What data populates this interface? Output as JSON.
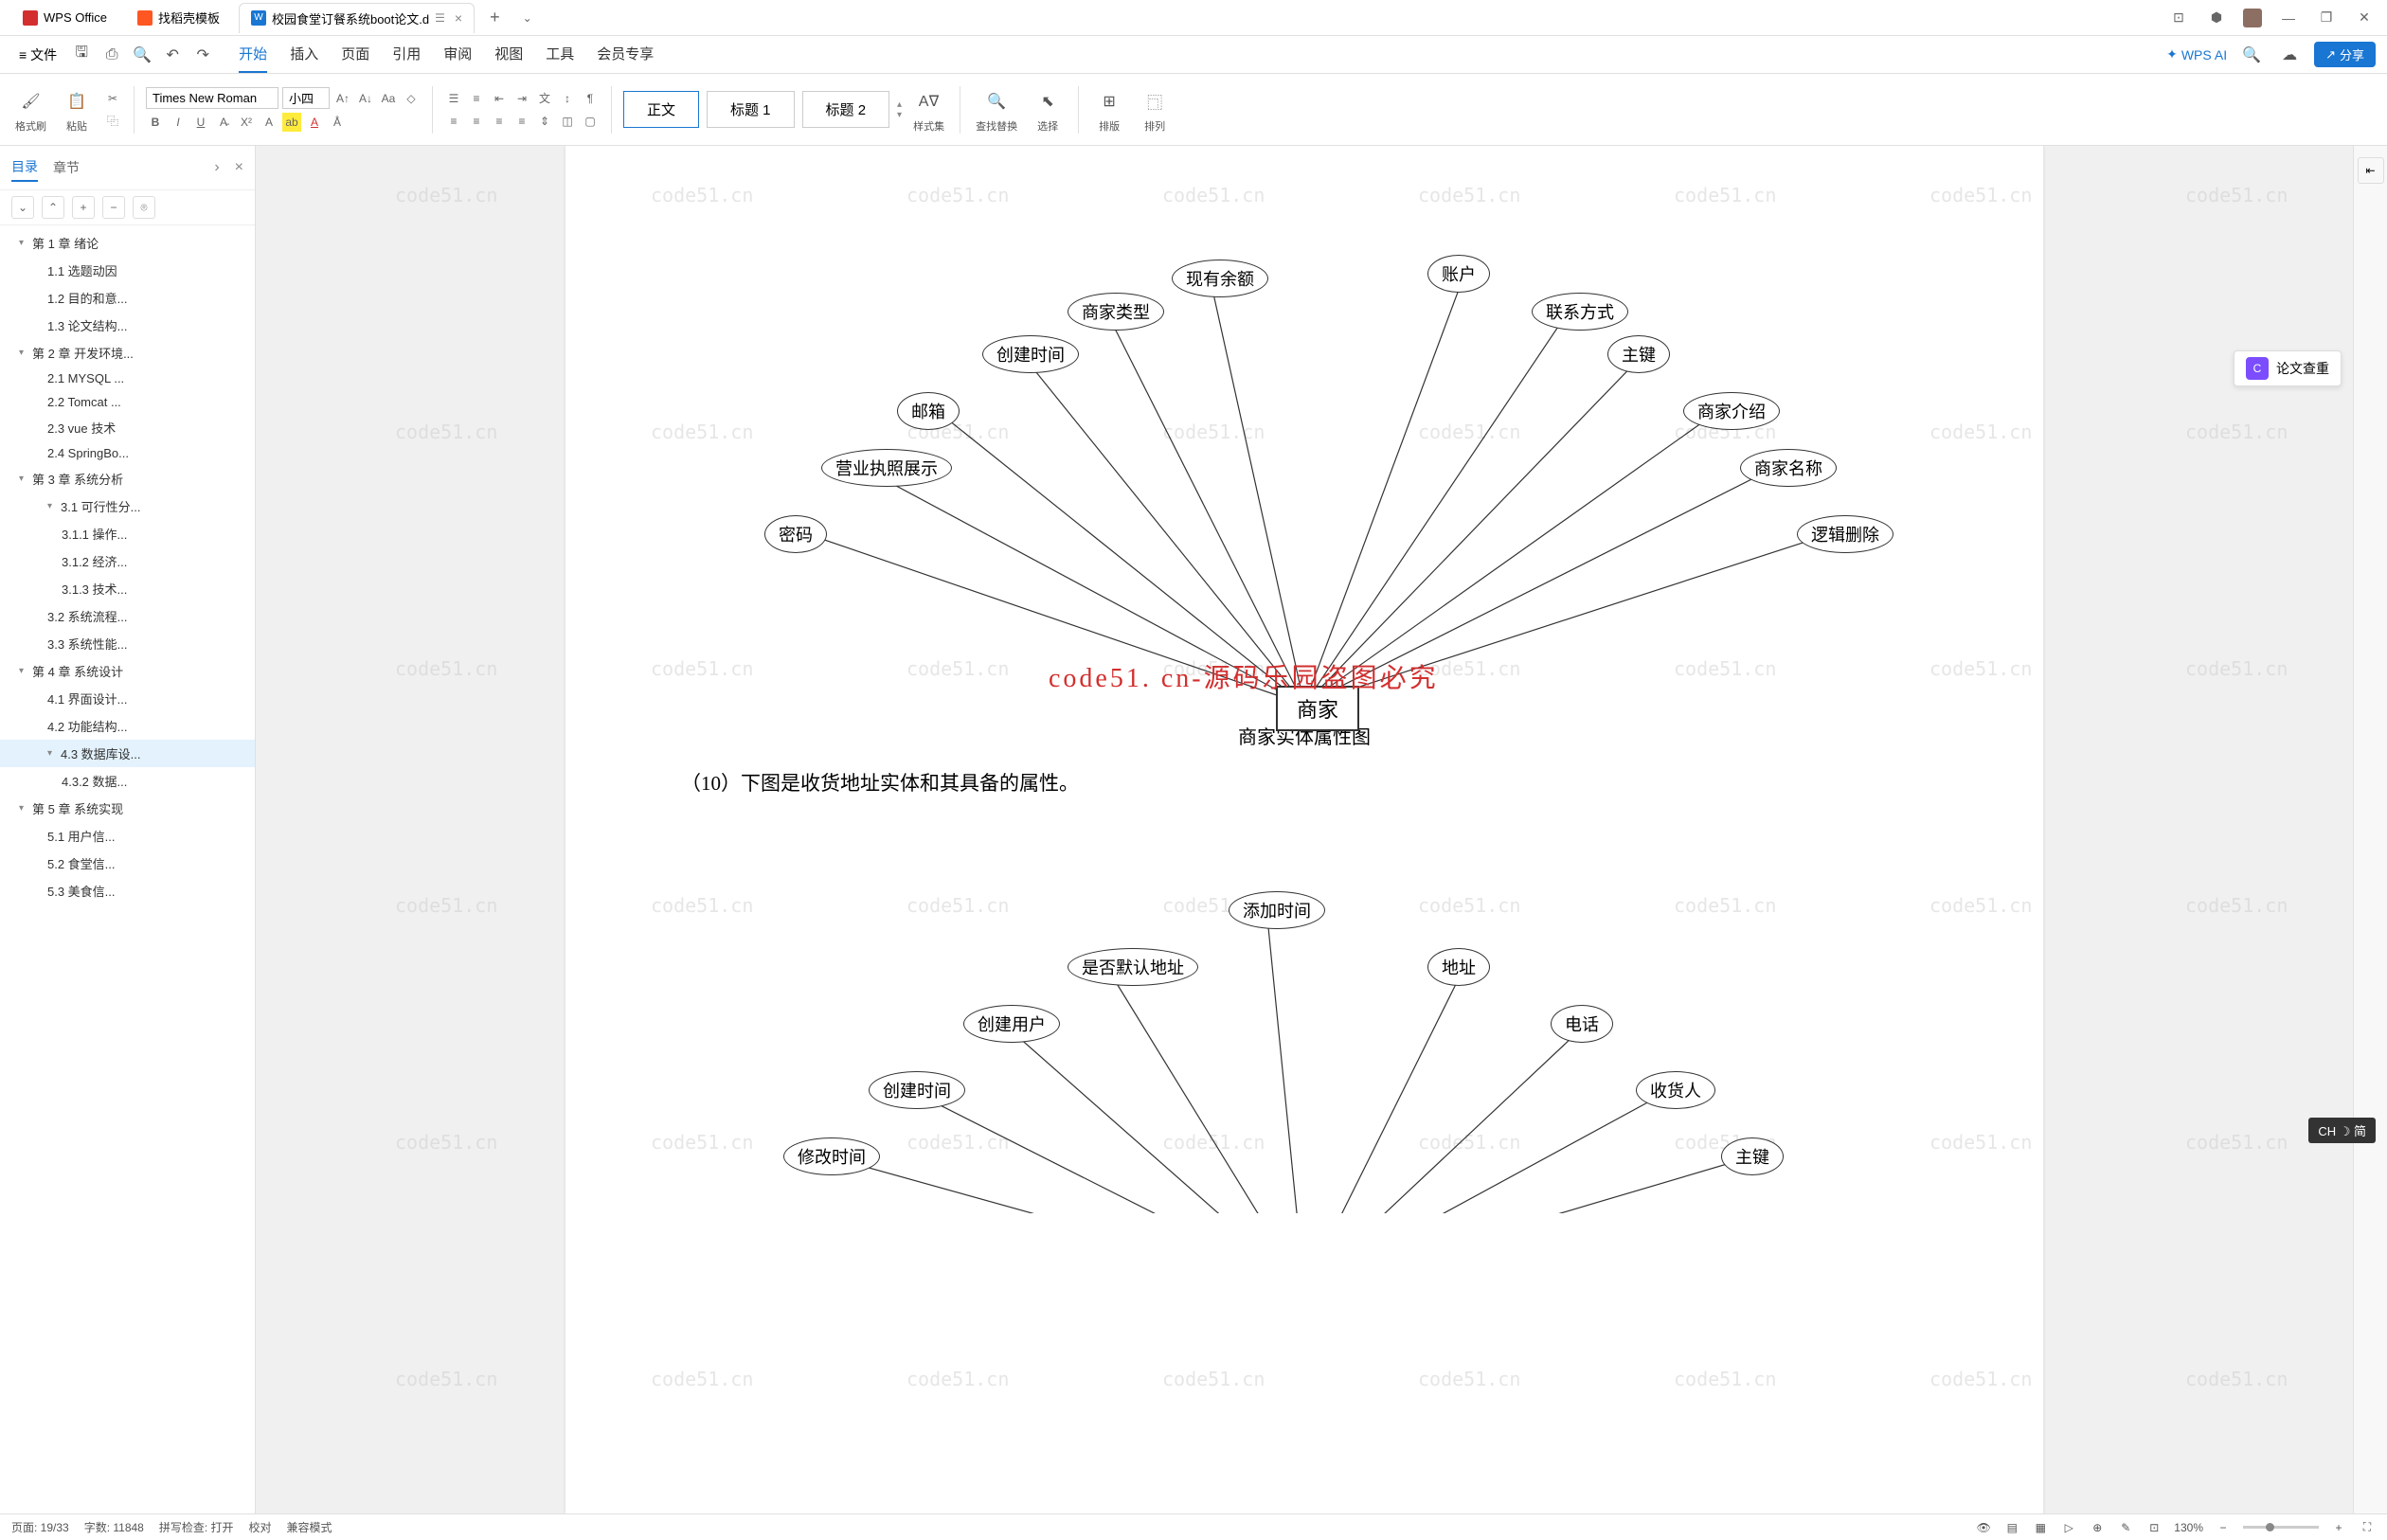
{
  "titlebar": {
    "app_name": "WPS Office",
    "tab2": "找稻壳模板",
    "tab3": "校园食堂订餐系统boot论文.d",
    "tab3_icon": "W"
  },
  "menubar": {
    "file": "文件",
    "tabs": [
      "开始",
      "插入",
      "页面",
      "引用",
      "审阅",
      "视图",
      "工具",
      "会员专享"
    ],
    "active_tab": 0,
    "wps_ai": "WPS AI",
    "share": "分享"
  },
  "ribbon": {
    "format_brush": "格式刷",
    "paste": "粘贴",
    "font": "Times New Roman",
    "size": "小四",
    "style_body": "正文",
    "style_h1": "标题 1",
    "style_h2": "标题 2",
    "styles": "样式集",
    "find_replace": "查找替换",
    "select": "选择",
    "arrange": "排版",
    "align": "排列"
  },
  "sidebar": {
    "tab1": "目录",
    "tab2": "章节",
    "items": [
      {
        "text": "第 1 章 绪论",
        "lvl": 1,
        "toggle": true
      },
      {
        "text": "1.1 选题动因",
        "lvl": 2
      },
      {
        "text": "1.2 目的和意...",
        "lvl": 2
      },
      {
        "text": "1.3 论文结构...",
        "lvl": 2
      },
      {
        "text": "第 2 章 开发环境...",
        "lvl": 1,
        "toggle": true
      },
      {
        "text": "2.1 MYSQL ...",
        "lvl": 2
      },
      {
        "text": "2.2 Tomcat ...",
        "lvl": 2
      },
      {
        "text": "2.3 vue 技术",
        "lvl": 2
      },
      {
        "text": "2.4 SpringBo...",
        "lvl": 2
      },
      {
        "text": "第 3 章 系统分析",
        "lvl": 1,
        "toggle": true
      },
      {
        "text": "3.1 可行性分...",
        "lvl": 2,
        "toggle": true
      },
      {
        "text": "3.1.1 操作...",
        "lvl": 3
      },
      {
        "text": "3.1.2 经济...",
        "lvl": 3
      },
      {
        "text": "3.1.3 技术...",
        "lvl": 3
      },
      {
        "text": "3.2 系统流程...",
        "lvl": 2
      },
      {
        "text": "3.3 系统性能...",
        "lvl": 2
      },
      {
        "text": "第 4 章 系统设计",
        "lvl": 1,
        "toggle": true
      },
      {
        "text": "4.1 界面设计...",
        "lvl": 2
      },
      {
        "text": "4.2 功能结构...",
        "lvl": 2
      },
      {
        "text": "4.3 数据库设...",
        "lvl": 2,
        "toggle": true,
        "active": true
      },
      {
        "text": "4.3.2 数据...",
        "lvl": 3
      },
      {
        "text": "第 5 章 系统实现",
        "lvl": 1,
        "toggle": true
      },
      {
        "text": "5.1 用户信...",
        "lvl": 2
      },
      {
        "text": "5.2 食堂信...",
        "lvl": 2
      },
      {
        "text": "5.3 美食信...",
        "lvl": 2
      }
    ]
  },
  "document": {
    "er1_center": "商家",
    "er1_attrs": [
      "密码",
      "营业执照展示",
      "邮箱",
      "创建时间",
      "商家类型",
      "现有余额",
      "账户",
      "联系方式",
      "主键",
      "商家介绍",
      "商家名称",
      "逻辑删除"
    ],
    "caption1": "商家实体属性图",
    "paragraph": "（10）下图是收货地址实体和其具备的属性。",
    "er2_attrs": [
      "修改时间",
      "创建时间",
      "创建用户",
      "是否默认地址",
      "添加时间",
      "地址",
      "电话",
      "收货人",
      "主键"
    ],
    "watermark_text": "code51.cn",
    "red_watermark": "code51. cn-源码乐园盗图必究"
  },
  "float_panel": {
    "label": "论文查重"
  },
  "statusbar": {
    "page": "页面: 19/33",
    "words": "字数: 11848",
    "spell": "拼写检查: 打开",
    "proof": "校对",
    "compat": "兼容模式",
    "zoom": "130%"
  },
  "ime": "CH ☽ 简"
}
